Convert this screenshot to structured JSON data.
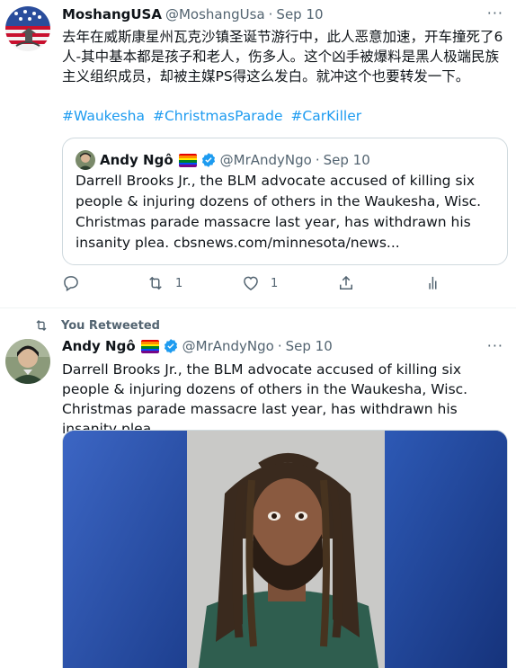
{
  "tweet1": {
    "name": "MoshangUSA",
    "handle": "@MoshangUsa",
    "dot": "·",
    "date": "Sep 10",
    "more": "···",
    "text": "去年在威斯康星州瓦克沙镇圣诞节游行中，此人恶意加速，开车撞死了6人-其中基本都是孩子和老人，伤多人。这个凶手被爆料是黑人极端民族主义组织成员，却被主媒PS得这么发白。就冲这个也要转发一下。",
    "hashtags": [
      "#Waukesha",
      "#ChristmasParade",
      "#CarKiller"
    ],
    "quote": {
      "name": "Andy Ngô",
      "handle": "@MrAndyNgo",
      "dot": "·",
      "date": "Sep 10",
      "text": "Darrell Brooks Jr., the BLM advocate accused of killing six people & injuring dozens of others in the Waukesha, Wisc. Christmas parade massacre last year, has withdrawn his insanity plea. cbsnews.com/minnesota/news..."
    },
    "actions": {
      "reply_count": "",
      "retweet_count": "1",
      "like_count": "1"
    }
  },
  "tweet2": {
    "retweet_label": "You Retweeted",
    "name": "Andy Ngô",
    "handle": "@MrAndyNgo",
    "dot": "·",
    "date": "Sep 10",
    "more": "···",
    "text": "Darrell Brooks Jr., the BLM advocate accused of killing six people & injuring dozens of others in the Waukesha, Wisc. Christmas parade massacre last year, has withdrawn his insanity plea."
  },
  "colors": {
    "link": "#1d9bf0",
    "secondary_text": "#536471",
    "border": "#cfd9de",
    "verified": "#1d9bf0"
  },
  "icons": [
    "reply-icon",
    "retweet-icon",
    "like-icon",
    "share-icon",
    "analytics-icon",
    "more-icon",
    "verified-icon",
    "rainbow-flag-icon"
  ]
}
